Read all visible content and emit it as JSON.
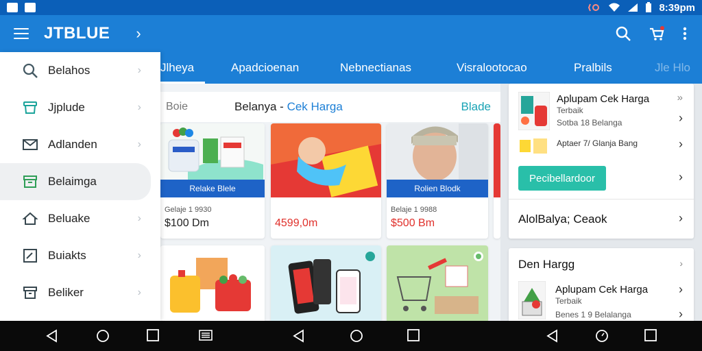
{
  "status_bar": {
    "time": "8:39pm"
  },
  "app_bar": {
    "title": "JTBLUE",
    "chevron": "›"
  },
  "tabs": [
    {
      "label": "Jlheya",
      "active": true
    },
    {
      "label": "Apadcioenan"
    },
    {
      "label": "Nebnectianas"
    },
    {
      "label": "Visralootocao"
    },
    {
      "label": "Pralbils"
    },
    {
      "label": "Jle Hlo"
    }
  ],
  "drawer": {
    "items": [
      {
        "label": "Belahos",
        "icon": "search-icon"
      },
      {
        "label": "Jjplude",
        "icon": "basket-icon"
      },
      {
        "label": "Adlanden",
        "icon": "mail-icon"
      },
      {
        "label": "Belaimga",
        "icon": "store-icon",
        "selected": true
      },
      {
        "label": "Beluake",
        "icon": "home-icon"
      },
      {
        "label": "Buiakts",
        "icon": "chart-icon"
      },
      {
        "label": "Beliker",
        "icon": "box-icon"
      }
    ]
  },
  "main": {
    "header_small": "Boie",
    "header_title": "Belanya",
    "header_dash": "-",
    "header_accent": "Cek Harga",
    "header_link": "Blade"
  },
  "products": [
    {
      "banner": "Relake Blele",
      "meta": "Gelaje 1 9930",
      "price": "$100 Dm",
      "price_color": "#222222"
    },
    {
      "banner": "",
      "meta": "",
      "price": "4599,0m",
      "price_color": "#e0302b"
    },
    {
      "banner": "Rolien Blodk",
      "meta": "Belaje 1 9988",
      "price": "$500 Bm",
      "price_color": "#e0302b"
    }
  ],
  "right_panel": {
    "card1": {
      "row1_title": "Aplupam Cek Harga",
      "row1_sub1": "Terbaik",
      "row1_sub2": "Sotba 18 Belanga",
      "row2_title": "Aptaer 7/ Glanja Bang",
      "button_label": "Pecibellardoor",
      "row3_title": "AlolBalya; Ceaok"
    },
    "card2": {
      "header": "Den Hargg",
      "row_title": "Aplupam Cek Harga",
      "row_sub1": "Terbaik",
      "row_sub2": "Benes 1 9 Belalanga"
    }
  },
  "colors": {
    "app_blue": "#1c7fd6",
    "status_blue": "#0b5fb8",
    "banner_blue": "#1e63c7",
    "teal": "#29bfa9",
    "price_red": "#e0302b"
  }
}
